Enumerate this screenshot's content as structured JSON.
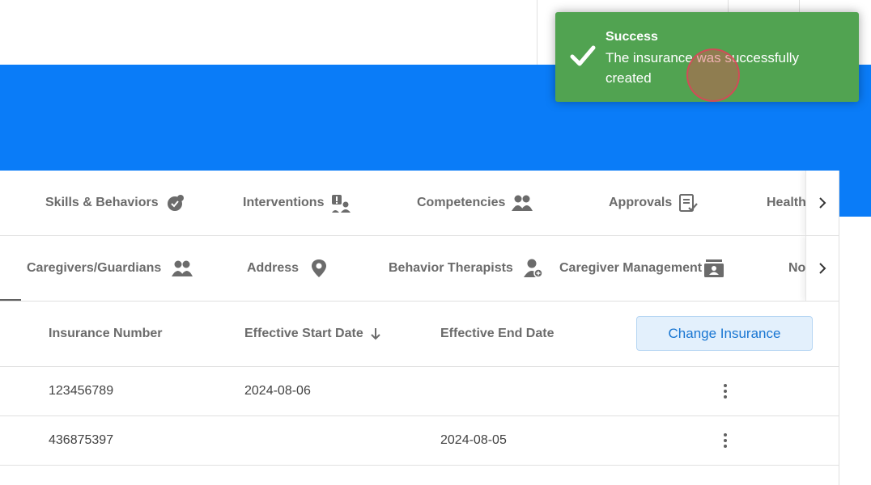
{
  "tabs_row1": [
    {
      "label": "Skills & Behaviors",
      "icon": "puzzle-icon"
    },
    {
      "label": "Interventions",
      "icon": "user-alert-icon"
    },
    {
      "label": "Competencies",
      "icon": "users-icon"
    },
    {
      "label": "Approvals",
      "icon": "checklist-icon"
    },
    {
      "label": "Health",
      "icon": ""
    }
  ],
  "tabs_row2": [
    {
      "label": "Caregivers/Guardians",
      "icon": "users-icon"
    },
    {
      "label": "Address",
      "icon": "location-pin-icon"
    },
    {
      "label": "Behavior Therapists",
      "icon": "user-plus-icon"
    },
    {
      "label": "Caregiver Management",
      "icon": "id-card-icon"
    },
    {
      "label": "No",
      "icon": ""
    }
  ],
  "table": {
    "columns": [
      "Insurance Number",
      "Effective Start Date",
      "Effective End Date"
    ],
    "sort_icon": "arrow-down-icon",
    "action_button": "Change Insurance",
    "rows": [
      {
        "insurance_number": "123456789",
        "start_date": "2024-08-06",
        "end_date": ""
      },
      {
        "insurance_number": "436875397",
        "start_date": "",
        "end_date": "2024-08-05"
      }
    ]
  },
  "toast": {
    "title": "Success",
    "message": "The insurance was successfully created",
    "icon": "check-icon"
  },
  "colors": {
    "banner": "#0a7cf8",
    "toast_bg": "#51a351",
    "primary_button_text": "#1976d2"
  }
}
